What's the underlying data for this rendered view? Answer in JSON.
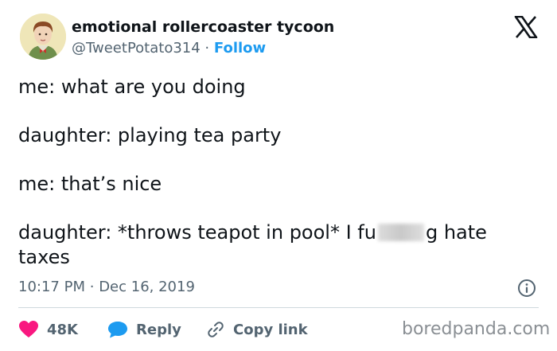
{
  "author": {
    "display_name": "emotional rollercoaster tycoon",
    "handle": "@TweetPotato314",
    "separator": "·",
    "follow_label": "Follow"
  },
  "tweet": {
    "lines": [
      "me: what are you doing",
      "daughter: playing tea party",
      "me: that’s nice",
      "daughter: *throws teapot in pool* I fu",
      "g hate",
      "taxes"
    ]
  },
  "meta": {
    "time": "10:17 PM",
    "separator": "·",
    "date": "Dec 16, 2019"
  },
  "actions": {
    "like_count": "48K",
    "reply_label": "Reply",
    "copy_label": "Copy link"
  },
  "watermark": "boredpanda.com",
  "colors": {
    "like": "#f91880",
    "reply": "#1d9bf0",
    "follow": "#1d9bf0",
    "muted": "#536471"
  },
  "icons": [
    "avatar",
    "x-logo-icon",
    "info-icon",
    "heart-icon",
    "reply-bubble-icon",
    "link-icon"
  ]
}
